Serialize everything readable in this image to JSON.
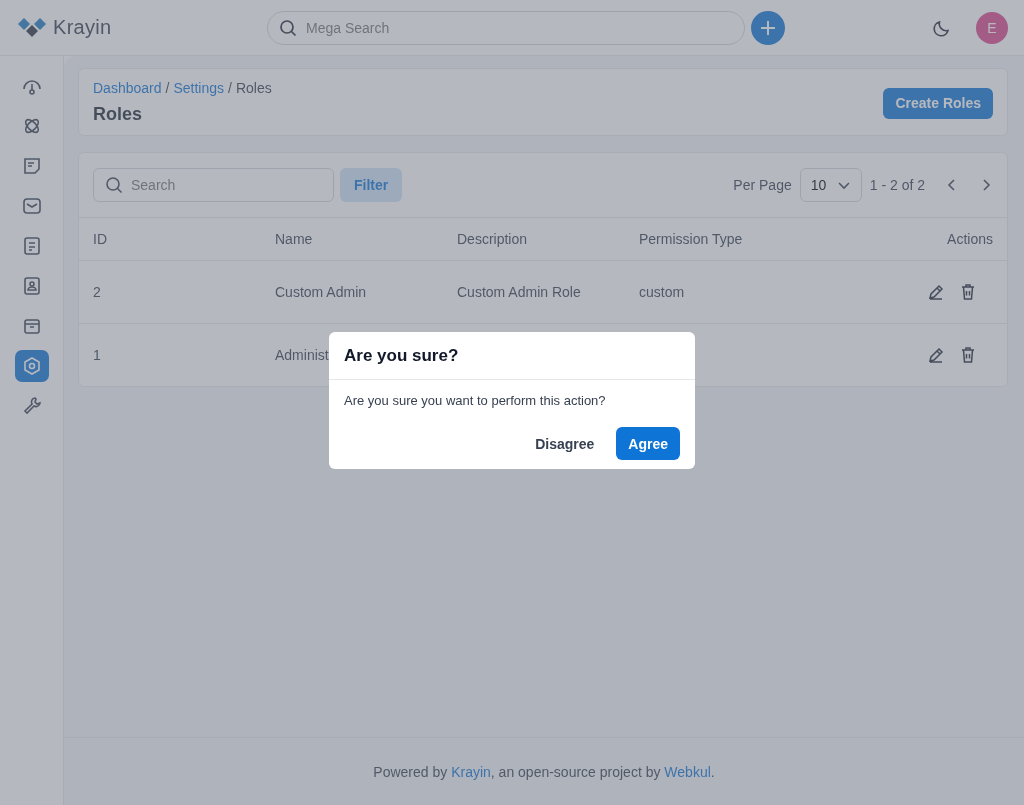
{
  "header": {
    "brand": "Krayin",
    "search": {
      "placeholder": "Mega Search"
    },
    "avatar": "E"
  },
  "sidebar": {
    "items": [
      {
        "selected": false
      },
      {
        "selected": false
      },
      {
        "selected": false
      },
      {
        "selected": false
      },
      {
        "selected": false
      },
      {
        "selected": false
      },
      {
        "selected": false
      },
      {
        "selected": true
      },
      {
        "selected": false
      }
    ]
  },
  "breadcrumb": [
    {
      "label": "Dashboard",
      "link": true,
      "separator": "/"
    },
    {
      "label": "Settings",
      "link": true,
      "separator": "/"
    },
    {
      "label": "Roles",
      "link": false
    }
  ],
  "page_title": "Roles",
  "create_button": "Create Roles",
  "toolbar": {
    "search": {
      "placeholder": "Search"
    },
    "filter": "Filter",
    "per_page_label": "Per Page",
    "per_page": "10",
    "range": "1 - 2 of 2"
  },
  "table": {
    "columns": [
      "ID",
      "Name",
      "Description",
      "Permission Type",
      "Actions"
    ],
    "rows": [
      {
        "cells": [
          "2",
          "Custom Admin",
          "Custom Admin Role",
          "custom"
        ]
      },
      {
        "cells": [
          "1",
          "Administ"
        ]
      }
    ]
  },
  "dialog": {
    "title": "Are you sure?",
    "message": "Are you sure you want to perform this action?",
    "buttons": [
      {
        "label": "Disagree",
        "kind": "secondary"
      },
      {
        "label": "Agree",
        "kind": "primary"
      }
    ]
  },
  "footer": {
    "prefix": "Powered by ",
    "link1": "Krayin",
    "middle": ", an open-source project by ",
    "link2": "Webkul",
    "suffix": "."
  }
}
